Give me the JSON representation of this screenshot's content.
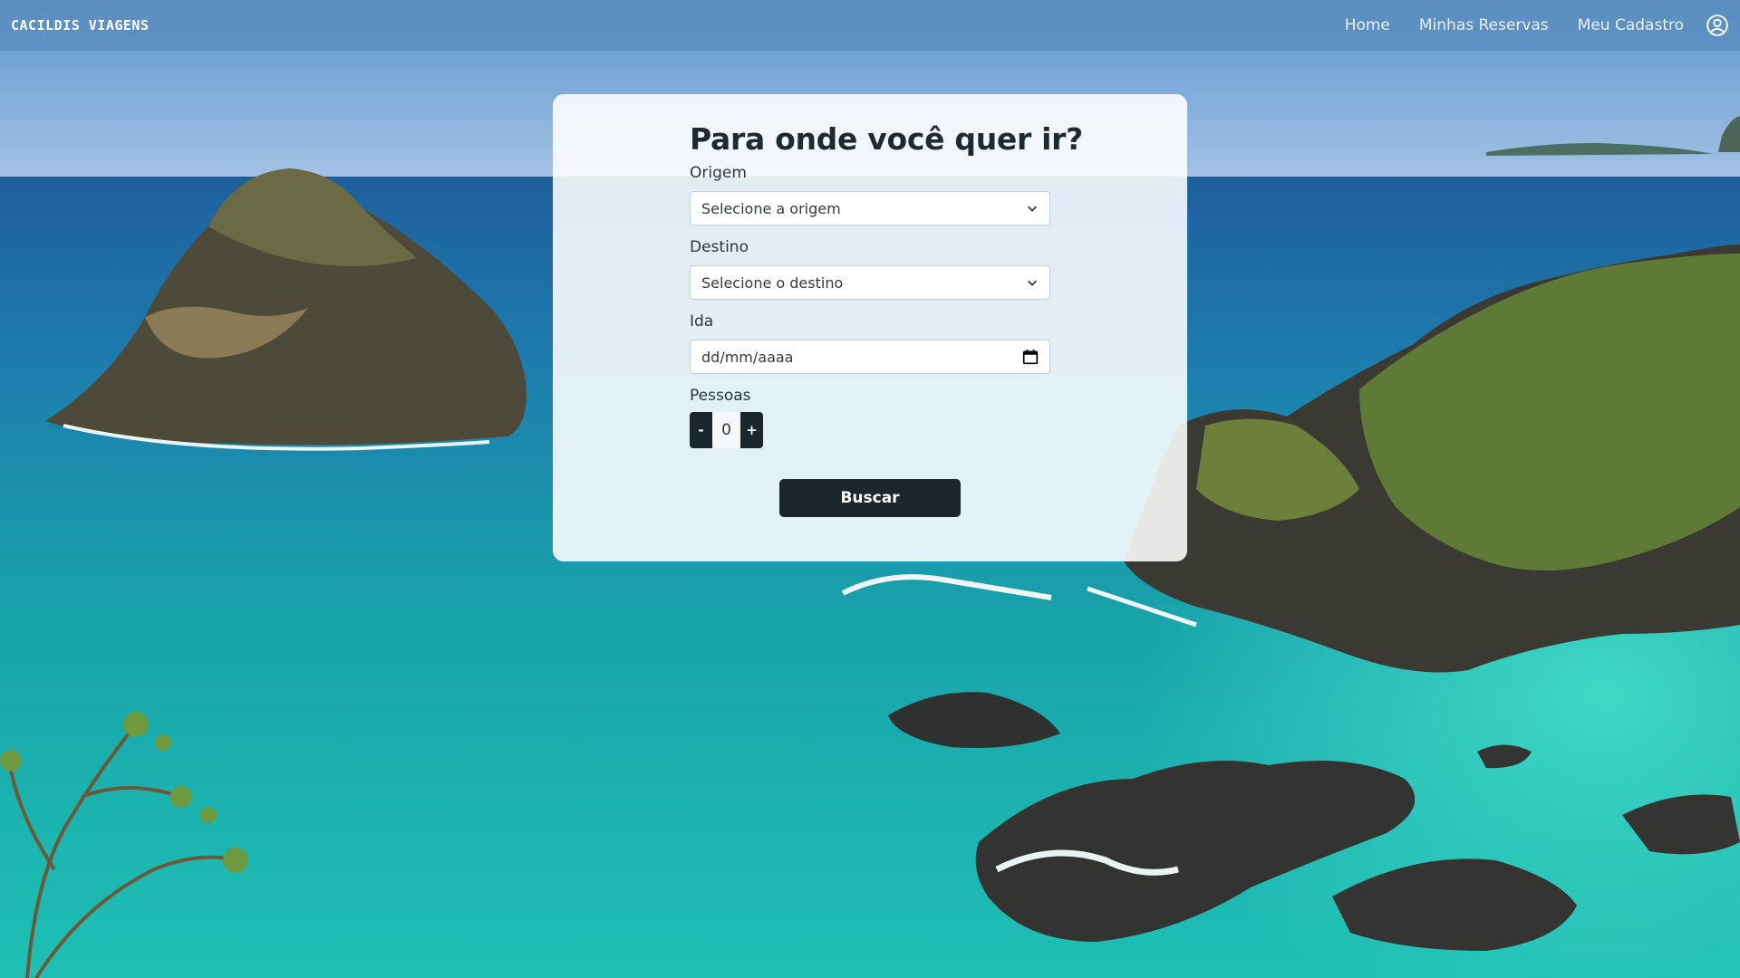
{
  "navbar": {
    "brand": "CACILDIS VIAGENS",
    "links": [
      "Home",
      "Minhas Reservas",
      "Meu Cadastro"
    ],
    "user_icon": "user-circle-icon"
  },
  "search_form": {
    "title": "Para onde você quer ir?",
    "origin": {
      "label": "Origem",
      "value": "Selecione a origem"
    },
    "destination": {
      "label": "Destino",
      "value": "Selecione o destino"
    },
    "departure": {
      "label": "Ida",
      "placeholder": "dd/mm/aaaa",
      "icon": "calendar-icon"
    },
    "people": {
      "label": "Pessoas",
      "minus": "-",
      "value": "0",
      "plus": "+"
    },
    "submit_label": "Buscar"
  },
  "colors": {
    "navbar": "#5a8cbe",
    "dark_button": "#1c262d",
    "sea": "#1aa5a8",
    "sky": "#6fa3d6"
  }
}
